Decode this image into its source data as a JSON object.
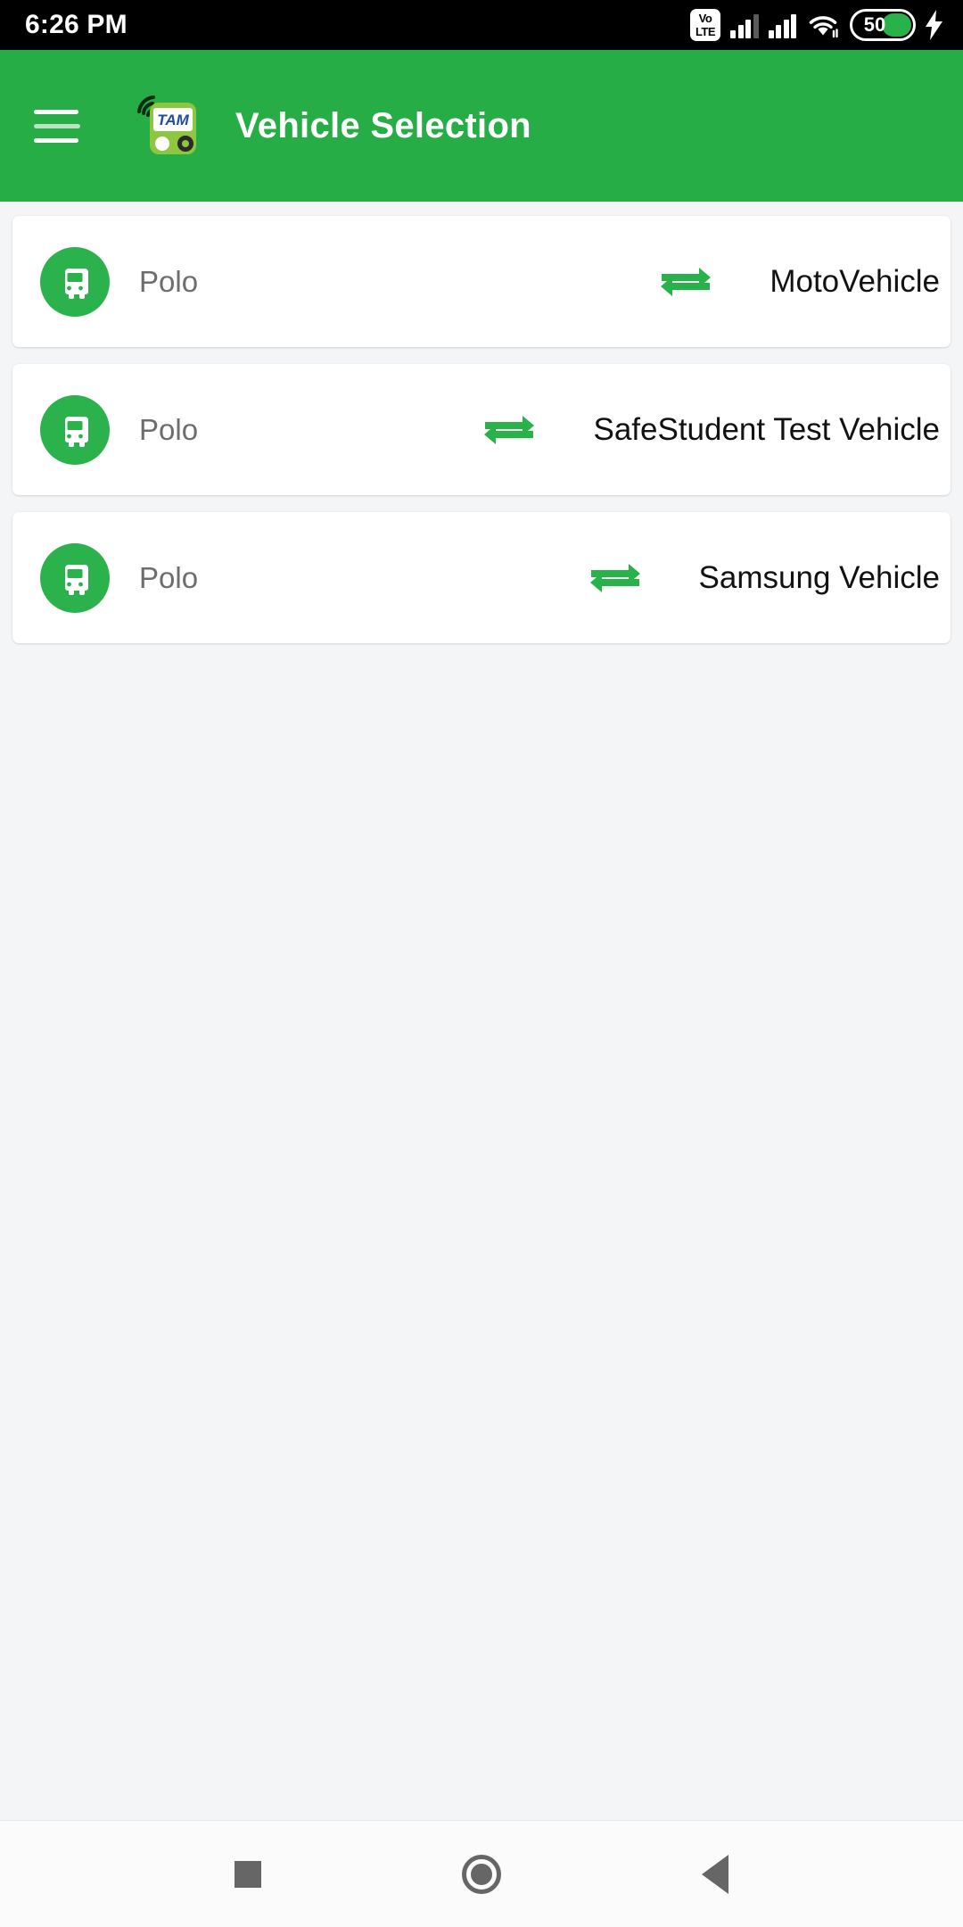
{
  "statusbar": {
    "time": "6:26 PM",
    "volte_top": "Vo",
    "volte_bottom": "LTE",
    "battery_percent": "50",
    "icons": [
      "volte-icon",
      "signal-bars-icon",
      "signal-bars-icon",
      "wifi-icon",
      "battery-icon",
      "charging-bolt-icon"
    ]
  },
  "appbar": {
    "menu_icon": "hamburger-menu-icon",
    "logo_text": "TAM",
    "logo_icon": "tam-bus-tracker-logo",
    "title": "Vehicle Selection",
    "background_color": "#27ad46"
  },
  "list": {
    "items": [
      {
        "plate": "Polo",
        "swap_icon": "swap-horizontal-icon",
        "vehicle_name": "MotoVehicle",
        "bus_icon": "bus-icon"
      },
      {
        "plate": "Polo",
        "swap_icon": "swap-horizontal-icon",
        "vehicle_name": "SafeStudent Test Vehicle",
        "bus_icon": "bus-icon"
      },
      {
        "plate": "Polo",
        "swap_icon": "swap-horizontal-icon",
        "vehicle_name": "Samsung Vehicle",
        "bus_icon": "bus-icon"
      }
    ]
  },
  "navbar": {
    "recents_label": "recents-square-icon",
    "home_label": "home-circle-icon",
    "back_label": "back-triangle-icon"
  },
  "colors": {
    "accent_green": "#27ad46",
    "badge_green": "#2bb24c",
    "swap_green": "#2ab24a",
    "page_bg": "#f4f5f7",
    "card_bg": "#ffffff",
    "plate_text": "#6d6d6d",
    "vehicle_text": "#121212"
  }
}
